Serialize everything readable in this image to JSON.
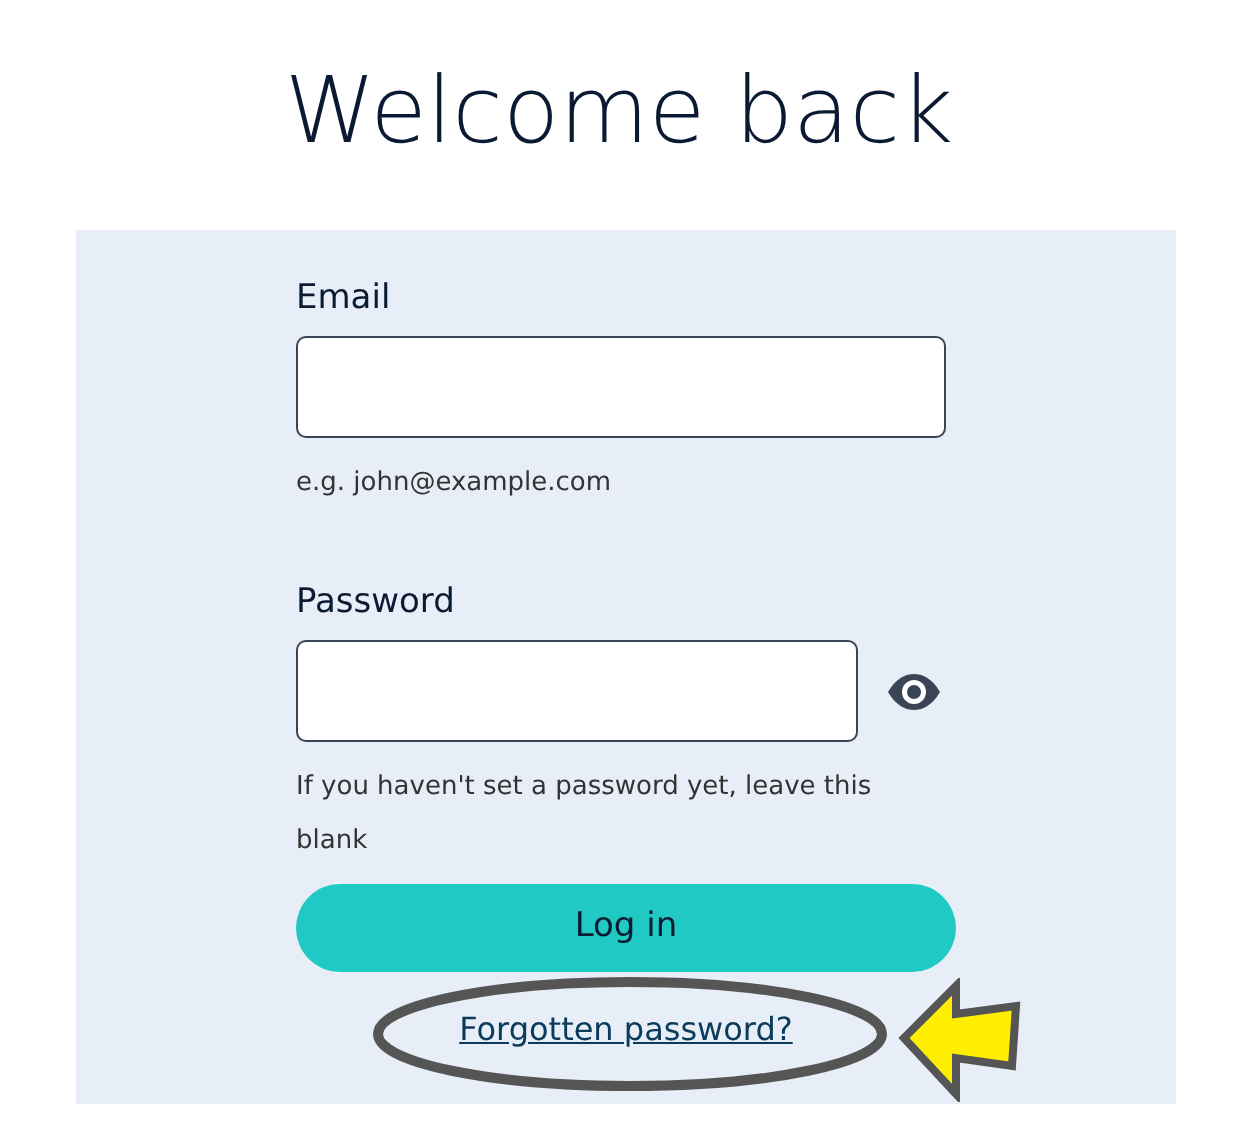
{
  "title": "Welcome back",
  "fields": [
    {
      "label": "Email",
      "hint": "e.g. john@example.com",
      "reveal_toggle": false
    },
    {
      "label": "Password",
      "hint": "If you haven't set a password yet, leave this blank",
      "reveal_toggle": true
    }
  ],
  "submit": "Log in",
  "link": "Forgotten password?",
  "annotation": {
    "circled": true,
    "arrow": true
  }
}
